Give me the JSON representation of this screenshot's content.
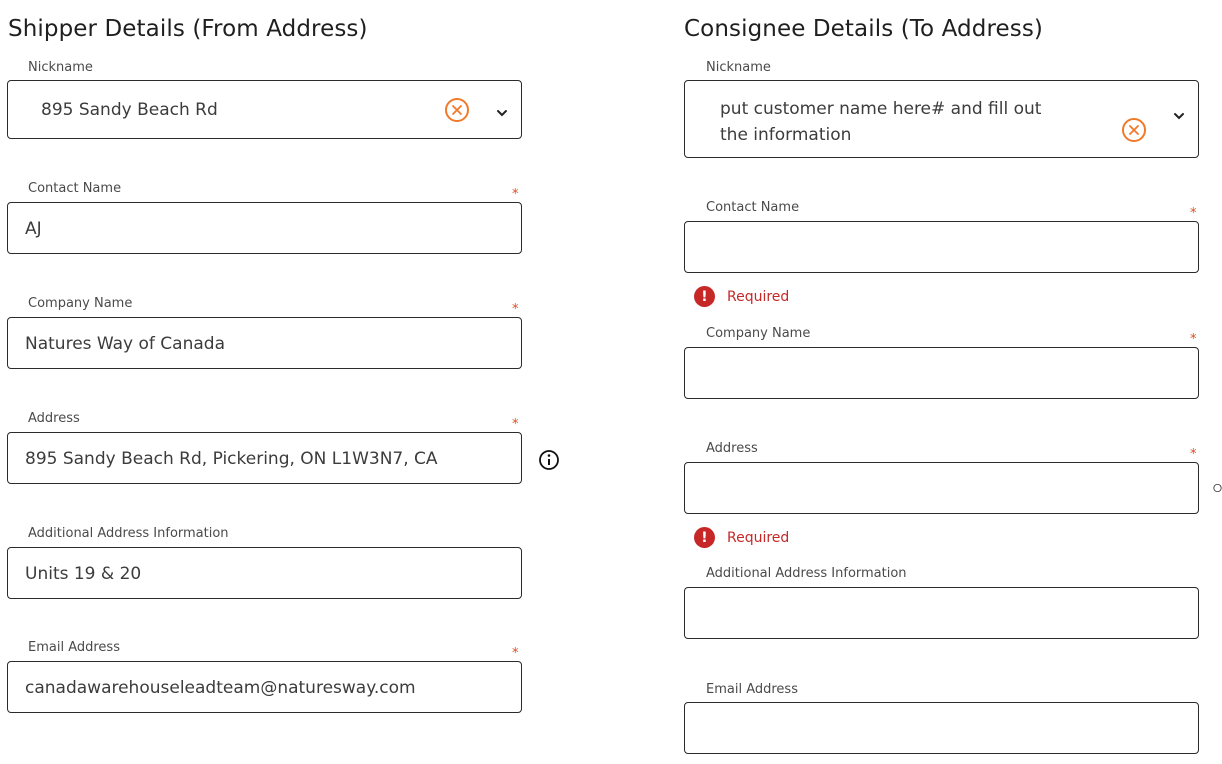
{
  "shipper": {
    "title": "Shipper Details (From Address)",
    "nickname_label": "Nickname",
    "nickname_value": "895 Sandy Beach Rd",
    "contact_label": "Contact Name",
    "contact_value": "AJ",
    "company_label": "Company Name",
    "company_value": "Natures Way of Canada",
    "address_label": "Address",
    "address_value": "895 Sandy Beach Rd, Pickering, ON L1W3N7, CA",
    "additional_label": "Additional Address Information",
    "additional_value": "Units 19 & 20",
    "email_label": "Email Address",
    "email_value": "canadawarehouseleadteam@naturesway.com"
  },
  "consignee": {
    "title": "Consignee Details (To Address)",
    "nickname_label": "Nickname",
    "nickname_line1": "put customer name here# and fill out",
    "nickname_line2": "the information",
    "contact_label": "Contact Name",
    "contact_value": "",
    "contact_error": "Required",
    "company_label": "Company Name",
    "company_value": "",
    "address_label": "Address",
    "address_value": "",
    "address_error": "Required",
    "additional_label": "Additional Address Information",
    "additional_value": "",
    "email_label": "Email Address",
    "email_value": ""
  },
  "required_marker": "*",
  "error_glyph": "!",
  "icons": {
    "clear": "close-circle-icon",
    "dropdown": "chevron-down-icon",
    "info": "info-circle-icon",
    "error": "exclamation-circle-icon"
  },
  "colors": {
    "required": "#e04a1f",
    "clear_icon": "#f07a2a",
    "error": "#c62828",
    "border": "#2b2b2b"
  }
}
